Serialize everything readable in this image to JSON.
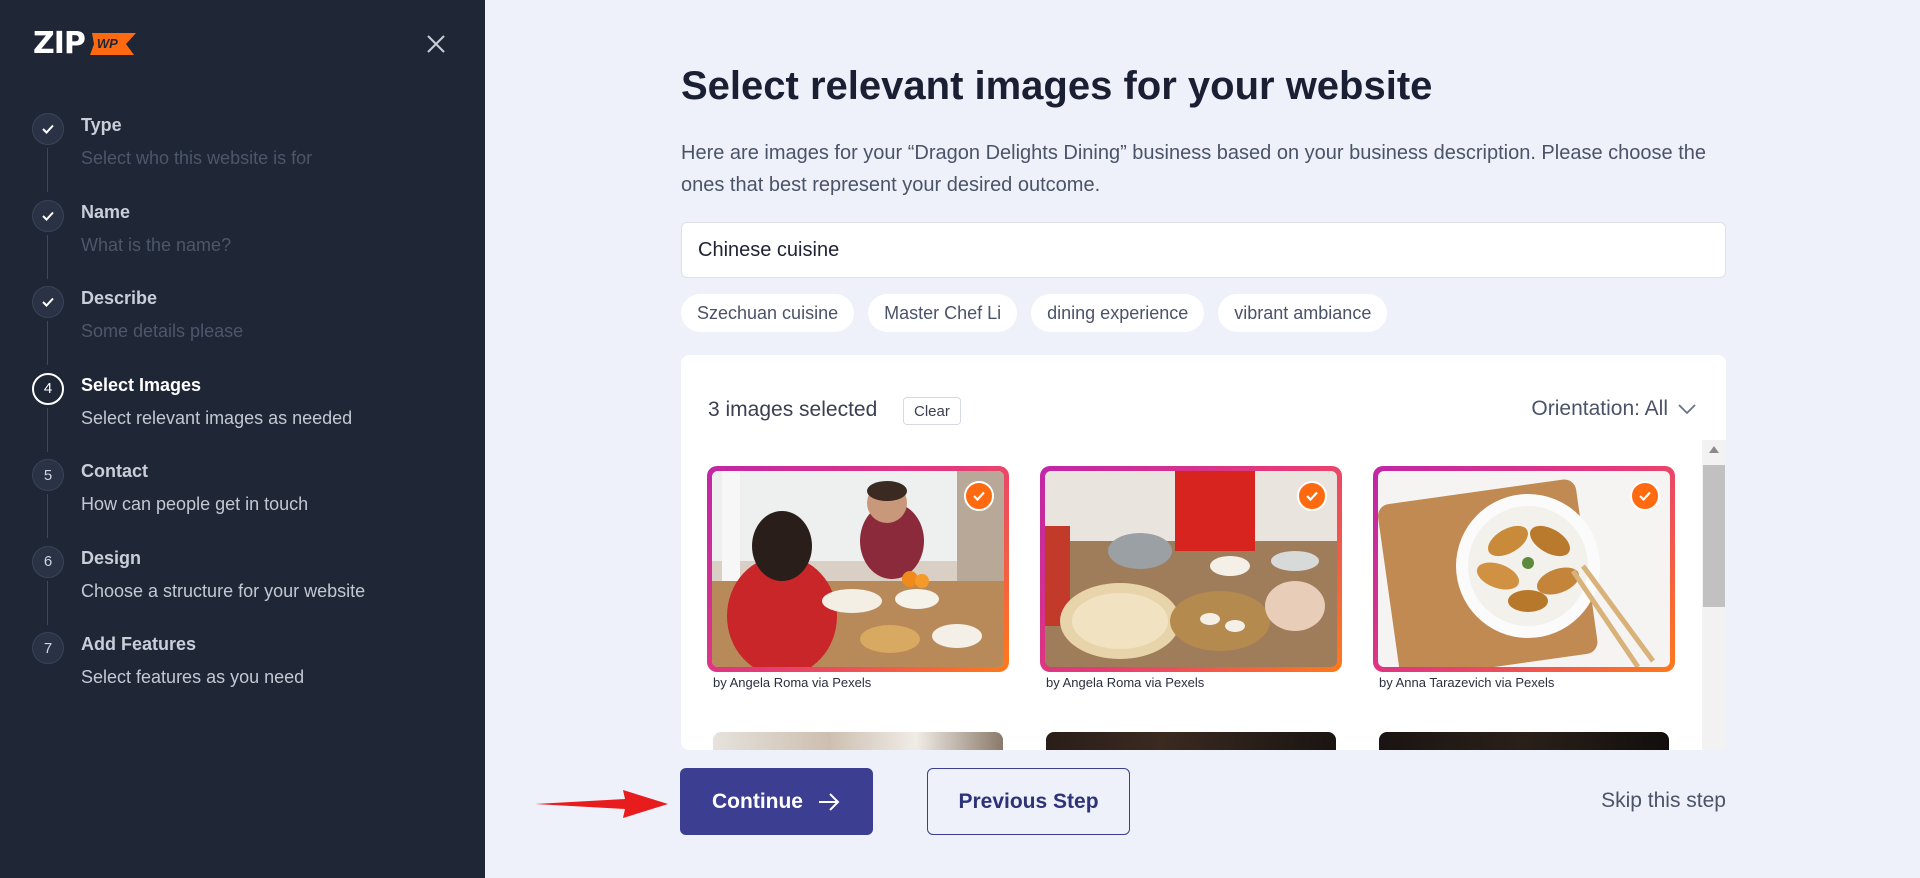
{
  "logo": {
    "text": "ZIP",
    "badge": "WP"
  },
  "steps": [
    {
      "num": "1",
      "title": "Type",
      "subtitle": "Select who this website is for",
      "state": "done"
    },
    {
      "num": "2",
      "title": "Name",
      "subtitle": "What is the name?",
      "state": "done"
    },
    {
      "num": "3",
      "title": "Describe",
      "subtitle": "Some details please",
      "state": "done"
    },
    {
      "num": "4",
      "title": "Select Images",
      "subtitle": "Select relevant images as needed",
      "state": "active"
    },
    {
      "num": "5",
      "title": "Contact",
      "subtitle": "How can people get in touch",
      "state": "upcoming"
    },
    {
      "num": "6",
      "title": "Design",
      "subtitle": "Choose a structure for your website",
      "state": "upcoming"
    },
    {
      "num": "7",
      "title": "Add Features",
      "subtitle": "Select features as you need",
      "state": "upcoming"
    }
  ],
  "main": {
    "title": "Select relevant images for your website",
    "description": "Here are images for your “Dragon Delights Dining” business based on your business description. Please choose the ones that best represent your desired outcome.",
    "search_value": "Chinese cuisine",
    "chips": [
      "Szechuan cuisine",
      "Master Chef Li",
      "dining experience",
      "vibrant ambiance"
    ]
  },
  "gallery": {
    "selected_text": "3 images selected",
    "clear_label": "Clear",
    "orientation_label": "Orientation: All",
    "images": [
      {
        "credit": "by Angela Roma via Pexels",
        "selected": true
      },
      {
        "credit": "by Angela Roma via Pexels",
        "selected": true
      },
      {
        "credit": "by Anna Tarazevich via Pexels",
        "selected": true
      }
    ]
  },
  "footer": {
    "continue_label": "Continue",
    "previous_label": "Previous Step",
    "skip_label": "Skip this step"
  },
  "colors": {
    "sidebar": "#1f2636",
    "primary": "#3b3e91",
    "accent": "#ff6a10",
    "annotation": "#e81c1c"
  }
}
